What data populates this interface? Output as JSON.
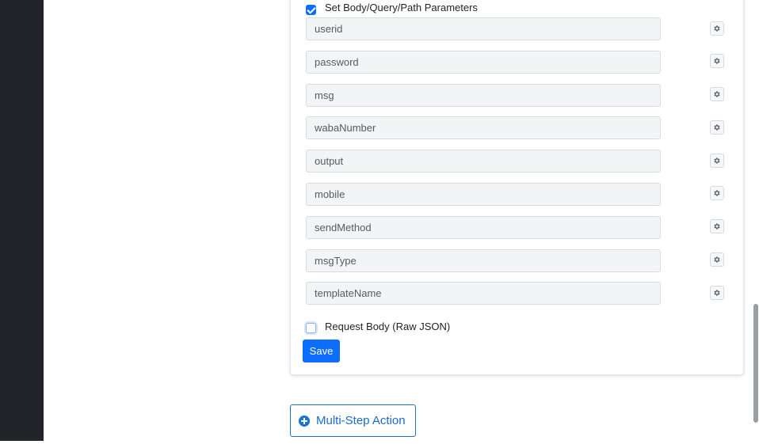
{
  "form": {
    "set_params": {
      "label": "Set Body/Query/Path Parameters",
      "checked": true
    },
    "params": [
      {
        "value": "userid"
      },
      {
        "value": "password"
      },
      {
        "value": "msg"
      },
      {
        "value": "wabaNumber"
      },
      {
        "value": "output"
      },
      {
        "value": "mobile"
      },
      {
        "value": "sendMethod"
      },
      {
        "value": "msgType"
      },
      {
        "value": "templateName"
      }
    ],
    "raw_json": {
      "label": "Request Body (Raw JSON)",
      "checked": false
    },
    "save_label": "Save"
  },
  "multistep": {
    "label": "Multi-Step Action",
    "icon": "plus-circle-icon"
  },
  "gear_icon": "gear-icon",
  "colors": {
    "primary": "#0d6efd",
    "sidebar": "#212529",
    "link": "#1a6cc9"
  }
}
